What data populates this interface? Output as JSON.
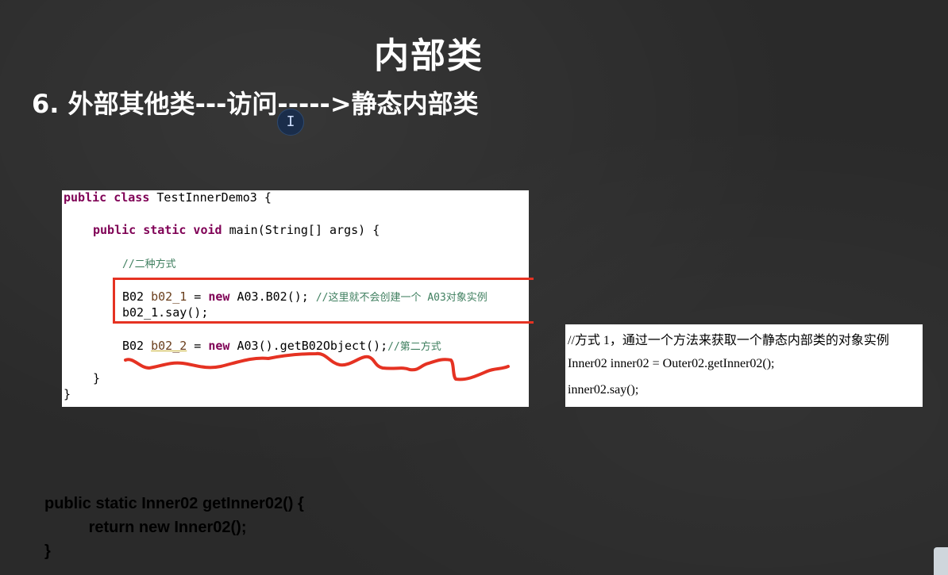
{
  "slide": {
    "title": "内部类",
    "subtitle": "6.  外部其他类---访问----->静态内部类"
  },
  "code_panel": {
    "line1_kw": "public class ",
    "line1_rest": "TestInnerDemo3 {",
    "line2_kw": "public static void ",
    "line2_rest": "main(String[] args) {",
    "line3_comment": "//二种方式",
    "line4_type": "B02 ",
    "line4_var": "b02_1",
    "line4_mid": " = ",
    "line4_new": "new ",
    "line4_rest": "A03.B02(); ",
    "line4_comment": "//这里就不会创建一个 A03对象实例",
    "line5": "b02_1.say();",
    "line6_type": "B02 ",
    "line6_var": "b02_2",
    "line6_mid": " = ",
    "line6_new": "new ",
    "line6_rest": "A03().getB02Object();",
    "line6_comment": "//第二方式",
    "line7": "}",
    "line8": "}"
  },
  "text_panel": {
    "line1": "//方式 1，通过一个方法来获取一个静态内部类的对象实例",
    "line2": "Inner02 inner02 = Outer02.getInner02();",
    "line3": "inner02.say();"
  },
  "bottom_code": {
    "line1": "public static Inner02 getInner02() {",
    "line2": "          return new Inner02();",
    "line3": "}"
  },
  "colors": {
    "highlight_box": "#e53222",
    "squiggle": "#e53222",
    "keyword": "#7f0055",
    "comment": "#3f7f5f"
  },
  "icons": {
    "cursor": "text-cursor-icon"
  }
}
